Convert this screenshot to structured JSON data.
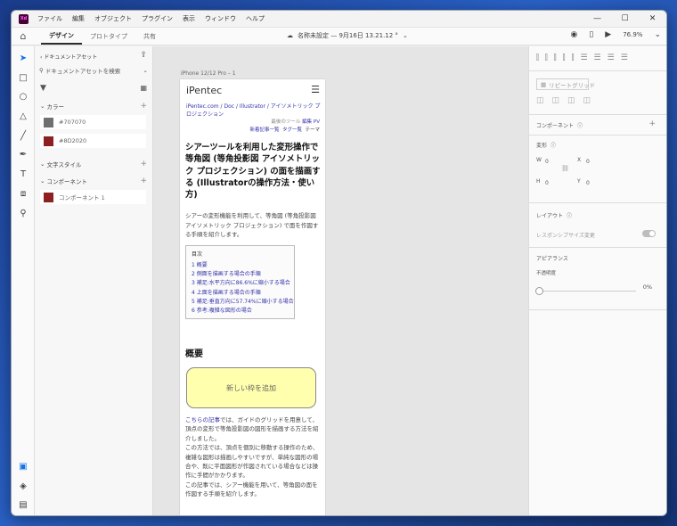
{
  "app": {
    "logo": "Xd",
    "menu": [
      "ファイル",
      "編集",
      "オブジェクト",
      "プラグイン",
      "表示",
      "ウィンドウ",
      "ヘルプ"
    ]
  },
  "toolbar": {
    "tabs": [
      "デザイン",
      "プロトタイプ",
      "共有"
    ],
    "doc_title": "名称未設定 — 9月16日 13.21.12 °",
    "zoom": "76.9%"
  },
  "assets": {
    "header": "ドキュメントアセット",
    "search_placeholder": "ドキュメントアセットを検索",
    "colors_label": "カラー",
    "colors": [
      {
        "name": "#707070",
        "hex": "#707070"
      },
      {
        "name": "#8D2020",
        "hex": "#8D2020"
      }
    ],
    "char_styles_label": "文字スタイル",
    "components_label": "コンポーネント",
    "components": [
      {
        "name": "コンポーネント 1",
        "hex": "#8D2020"
      }
    ]
  },
  "canvas": {
    "artboard_label": "iPhone 12/12 Pro – 1",
    "logo": "iPentec",
    "breadcrumb": [
      "iPentec.com",
      "Doc",
      "Illustrator",
      "アイソメトリック プロジェクション"
    ],
    "meta_line1": "最後のツール",
    "meta_edit": "編集",
    "meta_pv": "PV",
    "meta_new": "新着記事一覧",
    "meta_tags": "タグ一覧",
    "meta_theme": "テーマ",
    "title": "シアーツールを利用した変形操作で等角図 (等角投影図 アイソメトリック プロジェクション) の面を描画する (Illustratorの操作方法・使い方)",
    "lead": "シアーの変形機能を利用して、等角図 (等角投影図 アイソメトリック プロジェクション) で面を作図する手順を紹介します。",
    "toc_title": "目次",
    "toc": [
      "1 概要",
      "2 側面を描画する場合の手順",
      "3 補足:水平方向に86.6%に縮小する場合",
      "4 上面を描画する場合の手順",
      "5 補足:垂直方向に57.74%に縮小する場合",
      "6 参考:複雑な図形の場合"
    ],
    "section_heading": "概要",
    "new_frame": "新しい枠を追加",
    "body_link": "こちらの記事",
    "body1": "では、ガイドのグリッドを用意して、頂点の変形で等角投影図の図形を描画する方法を紹介しました。",
    "body2": "この方法では、頂点を個別に移動する操作のため、複雑な図形は描画しやすいですが、単純な図形の場合や、既に平面図形が作図されている場合などは操作に手間がかかります。",
    "body3": "この記事では、シアー機能を用いて、等角図の面を作図する手順を紹介します。"
  },
  "props": {
    "repeat_grid": "リピートグリッド",
    "component_label": "コンポーネント",
    "transform_label": "変形",
    "w_label": "W",
    "w_value": "0",
    "h_label": "H",
    "h_value": "0",
    "x_label": "X",
    "x_value": "0",
    "y_label": "Y",
    "y_value": "0",
    "layout_label": "レイアウト",
    "responsive_label": "レスポンシブサイズ変更",
    "appearance_label": "アピアランス",
    "opacity_label": "不透明度",
    "opacity_value": "0%",
    "opacity": 0
  }
}
